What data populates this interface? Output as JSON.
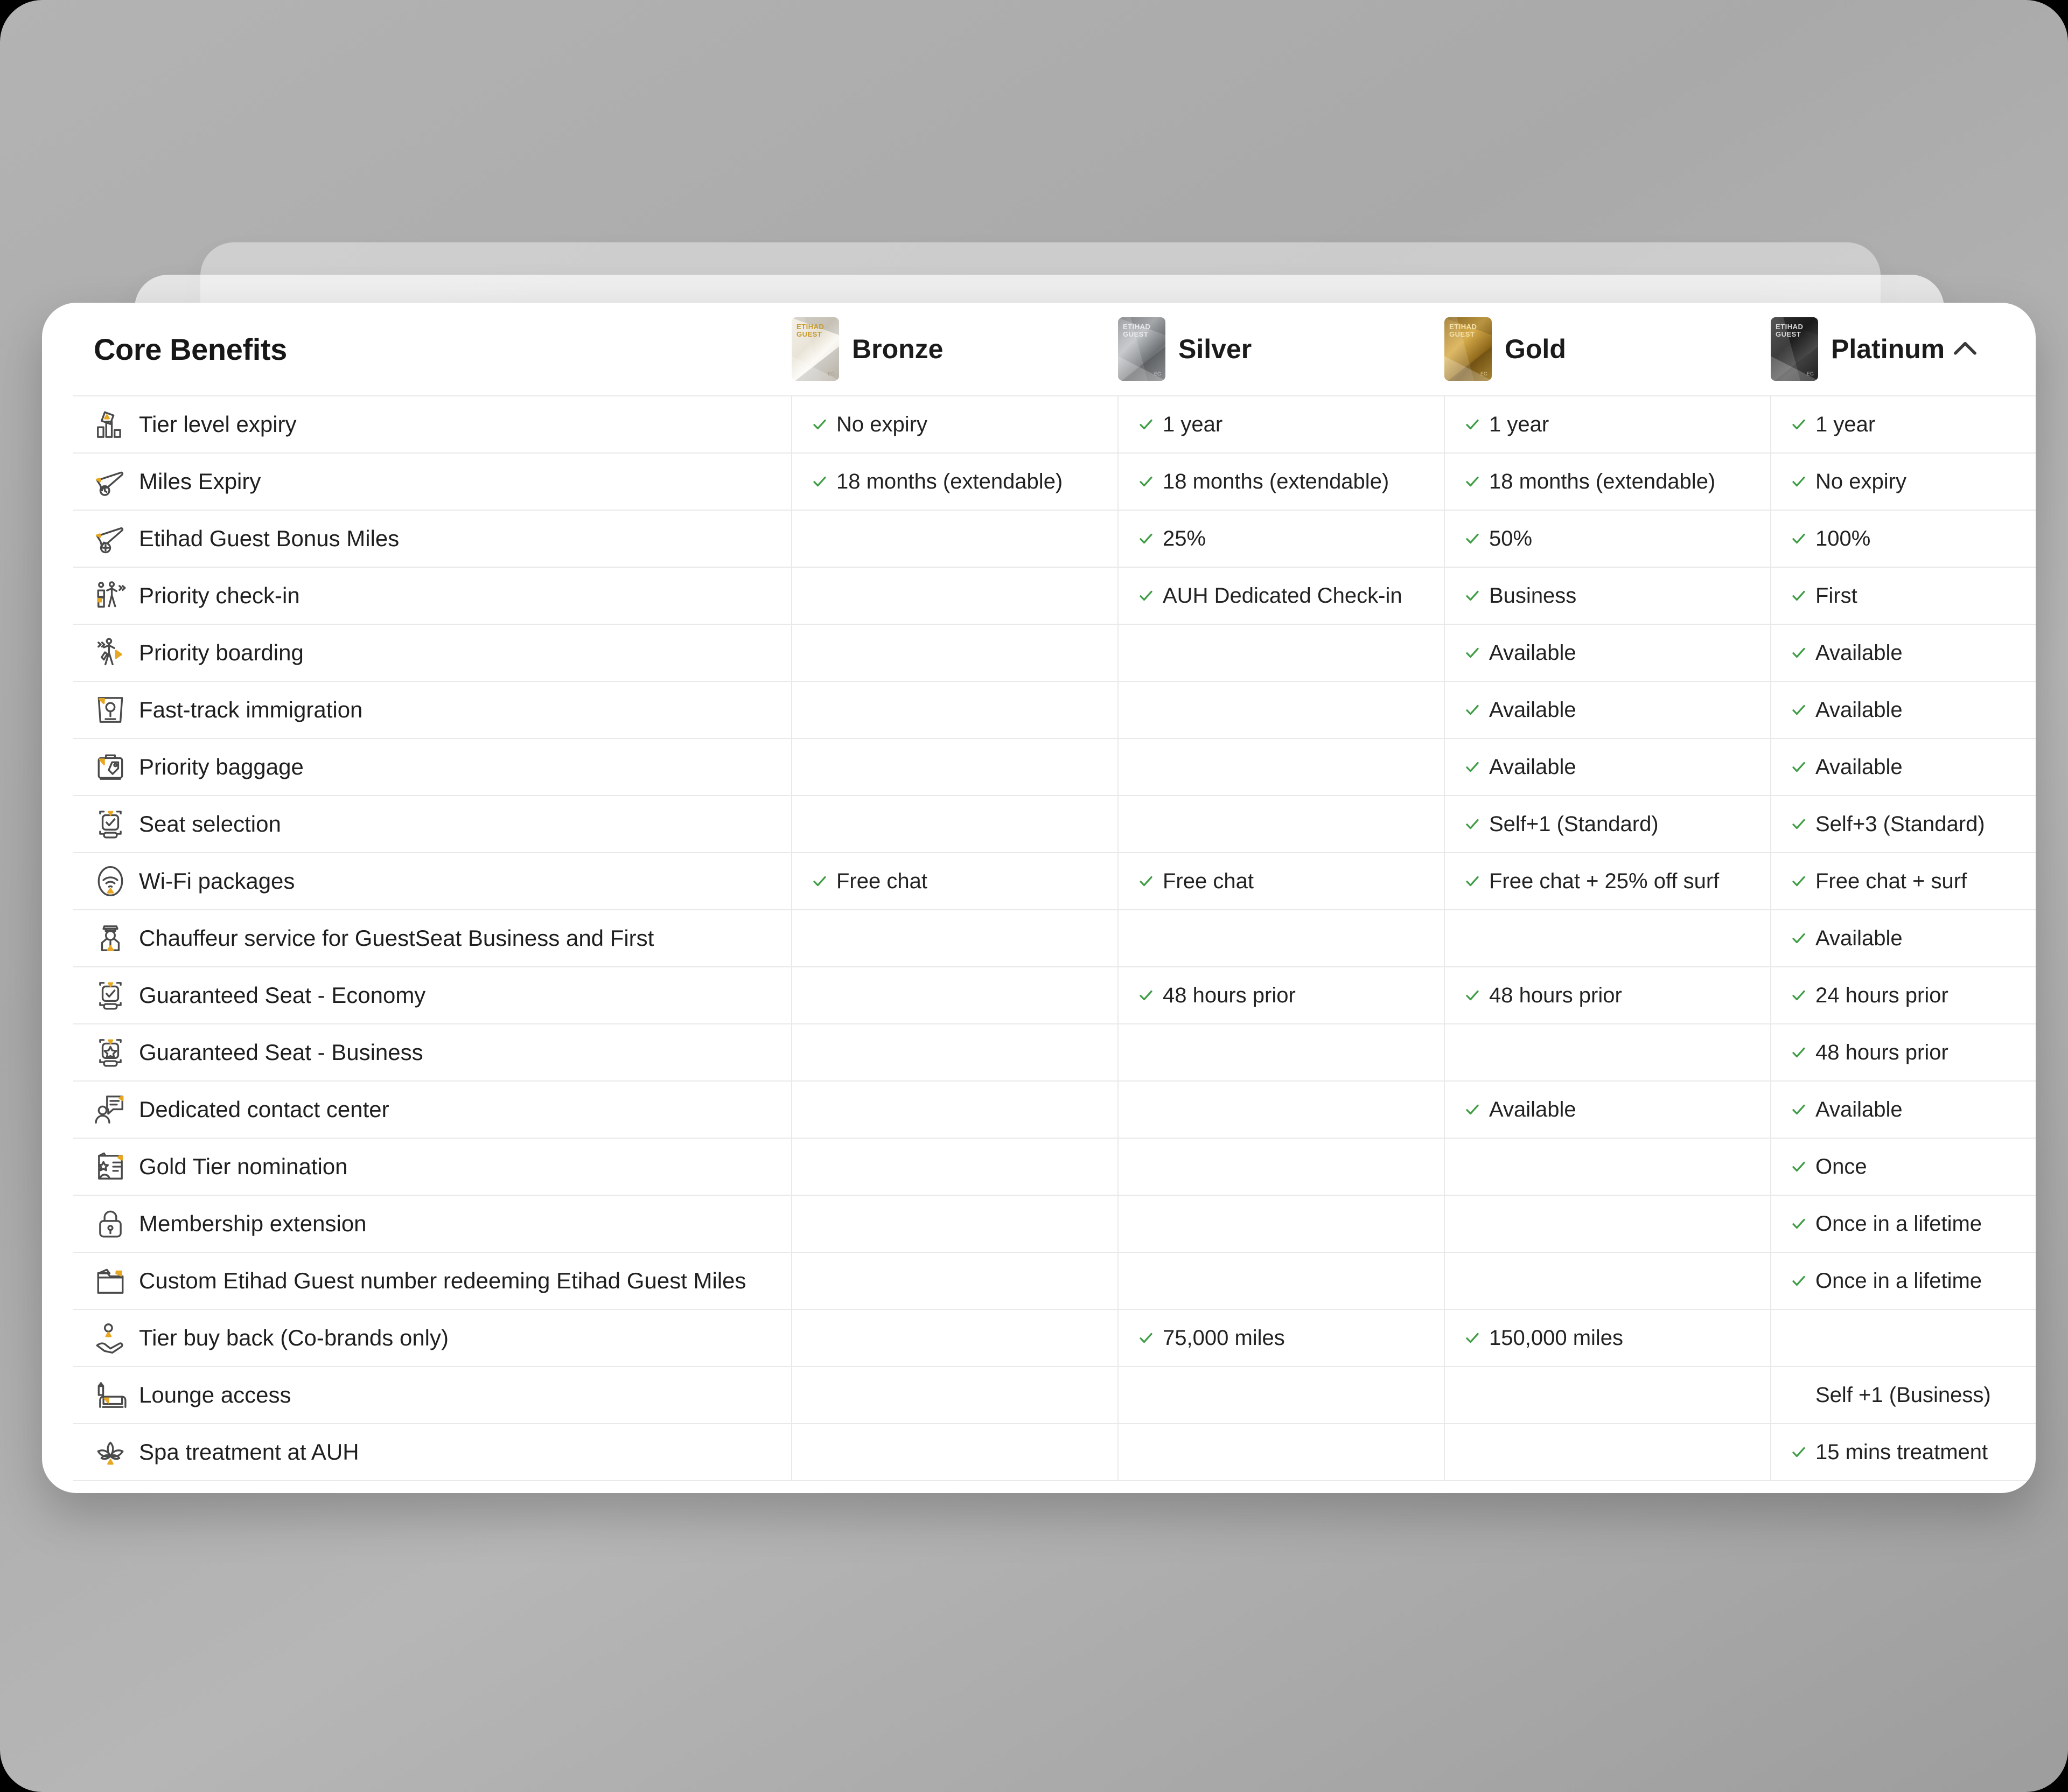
{
  "panel": {
    "title": "Core Benefits",
    "collapse_icon": "chevron-up-icon",
    "check_color": "#3f9e45",
    "accent_color": "#e8a723"
  },
  "tiers": [
    {
      "name": "Bronze",
      "card_logo": "ETIHAD GUEST",
      "card_mark": "EG"
    },
    {
      "name": "Silver",
      "card_logo": "ETIHAD GUEST",
      "card_mark": "EG"
    },
    {
      "name": "Gold",
      "card_logo": "ETIHAD GUEST",
      "card_mark": "EG"
    },
    {
      "name": "Platinum",
      "card_logo": "ETIHAD GUEST",
      "card_mark": "EG"
    }
  ],
  "rows": [
    {
      "icon": "tier-chart-icon",
      "label": "Tier level expiry",
      "cells": [
        {
          "check": true,
          "text": "No expiry"
        },
        {
          "check": true,
          "text": "1 year"
        },
        {
          "check": true,
          "text": "1 year"
        },
        {
          "check": true,
          "text": "1 year"
        }
      ]
    },
    {
      "icon": "plane-clock-icon",
      "label": "Miles Expiry",
      "cells": [
        {
          "check": true,
          "text": "18 months (extendable)"
        },
        {
          "check": true,
          "text": "18 months (extendable)"
        },
        {
          "check": true,
          "text": "18 months (extendable)"
        },
        {
          "check": true,
          "text": "No expiry"
        }
      ]
    },
    {
      "icon": "plane-plus-icon",
      "label": "Etihad Guest Bonus Miles",
      "cells": [
        {
          "check": false,
          "text": ""
        },
        {
          "check": true,
          "text": "25%"
        },
        {
          "check": true,
          "text": "50%"
        },
        {
          "check": true,
          "text": "100%"
        }
      ]
    },
    {
      "icon": "check-in-desk-icon",
      "label": "Priority check-in",
      "cells": [
        {
          "check": false,
          "text": ""
        },
        {
          "check": true,
          "text": "AUH Dedicated Check-in"
        },
        {
          "check": true,
          "text": "Business"
        },
        {
          "check": true,
          "text": "First"
        }
      ]
    },
    {
      "icon": "boarding-walker-icon",
      "label": "Priority boarding",
      "cells": [
        {
          "check": false,
          "text": ""
        },
        {
          "check": false,
          "text": ""
        },
        {
          "check": true,
          "text": "Available"
        },
        {
          "check": true,
          "text": "Available"
        }
      ]
    },
    {
      "icon": "passport-stamp-icon",
      "label": "Fast-track immigration",
      "cells": [
        {
          "check": false,
          "text": ""
        },
        {
          "check": false,
          "text": ""
        },
        {
          "check": true,
          "text": "Available"
        },
        {
          "check": true,
          "text": "Available"
        }
      ]
    },
    {
      "icon": "suitcase-tag-icon",
      "label": "Priority baggage",
      "cells": [
        {
          "check": false,
          "text": ""
        },
        {
          "check": false,
          "text": ""
        },
        {
          "check": true,
          "text": "Available"
        },
        {
          "check": true,
          "text": "Available"
        }
      ]
    },
    {
      "icon": "seat-check-icon",
      "label": "Seat selection",
      "cells": [
        {
          "check": false,
          "text": ""
        },
        {
          "check": false,
          "text": ""
        },
        {
          "check": true,
          "text": "Self+1 (Standard)"
        },
        {
          "check": true,
          "text": "Self+3 (Standard)"
        }
      ]
    },
    {
      "icon": "wifi-icon",
      "label": "Wi-Fi packages",
      "cells": [
        {
          "check": true,
          "text": "Free chat"
        },
        {
          "check": true,
          "text": "Free chat"
        },
        {
          "check": true,
          "text": "Free chat + 25% off surf"
        },
        {
          "check": true,
          "text": "Free chat + surf"
        }
      ]
    },
    {
      "icon": "chauffeur-icon",
      "label": "Chauffeur service for GuestSeat Business and First",
      "cells": [
        {
          "check": false,
          "text": ""
        },
        {
          "check": false,
          "text": ""
        },
        {
          "check": false,
          "text": ""
        },
        {
          "check": true,
          "text": "Available"
        }
      ]
    },
    {
      "icon": "seat-check-icon",
      "label": "Guaranteed Seat - Economy",
      "cells": [
        {
          "check": false,
          "text": ""
        },
        {
          "check": true,
          "text": "48 hours prior"
        },
        {
          "check": true,
          "text": "48 hours prior"
        },
        {
          "check": true,
          "text": "24 hours prior"
        }
      ]
    },
    {
      "icon": "seat-star-icon",
      "label": "Guaranteed Seat - Business",
      "cells": [
        {
          "check": false,
          "text": ""
        },
        {
          "check": false,
          "text": ""
        },
        {
          "check": false,
          "text": ""
        },
        {
          "check": true,
          "text": "48 hours prior"
        }
      ]
    },
    {
      "icon": "agent-chat-icon",
      "label": "Dedicated contact center",
      "cells": [
        {
          "check": false,
          "text": ""
        },
        {
          "check": false,
          "text": ""
        },
        {
          "check": true,
          "text": "Available"
        },
        {
          "check": true,
          "text": "Available"
        }
      ]
    },
    {
      "icon": "nomination-card-icon",
      "label": "Gold Tier nomination",
      "cells": [
        {
          "check": false,
          "text": ""
        },
        {
          "check": false,
          "text": ""
        },
        {
          "check": false,
          "text": ""
        },
        {
          "check": true,
          "text": "Once"
        }
      ]
    },
    {
      "icon": "lock-icon",
      "label": "Membership extension",
      "cells": [
        {
          "check": false,
          "text": ""
        },
        {
          "check": false,
          "text": ""
        },
        {
          "check": false,
          "text": ""
        },
        {
          "check": true,
          "text": "Once in a lifetime"
        }
      ]
    },
    {
      "icon": "folder-icon",
      "label": "Custom Etihad Guest number redeeming Etihad Guest Miles",
      "cells": [
        {
          "check": false,
          "text": ""
        },
        {
          "check": false,
          "text": ""
        },
        {
          "check": false,
          "text": ""
        },
        {
          "check": true,
          "text": "Once in a lifetime"
        }
      ]
    },
    {
      "icon": "hand-coin-icon",
      "label": "Tier buy back (Co-brands only)",
      "cells": [
        {
          "check": false,
          "text": ""
        },
        {
          "check": true,
          "text": "75,000 miles"
        },
        {
          "check": true,
          "text": "150,000 miles"
        },
        {
          "check": false,
          "text": ""
        }
      ]
    },
    {
      "icon": "lounge-chair-icon",
      "label": "Lounge access",
      "cells": [
        {
          "check": false,
          "text": ""
        },
        {
          "check": false,
          "text": ""
        },
        {
          "check": false,
          "text": ""
        },
        {
          "check": false,
          "text": "Self +1 (Business)"
        }
      ]
    },
    {
      "icon": "lotus-spa-icon",
      "label": "Spa treatment at AUH",
      "cells": [
        {
          "check": false,
          "text": ""
        },
        {
          "check": false,
          "text": ""
        },
        {
          "check": false,
          "text": ""
        },
        {
          "check": true,
          "text": "15 mins treatment"
        }
      ]
    }
  ]
}
